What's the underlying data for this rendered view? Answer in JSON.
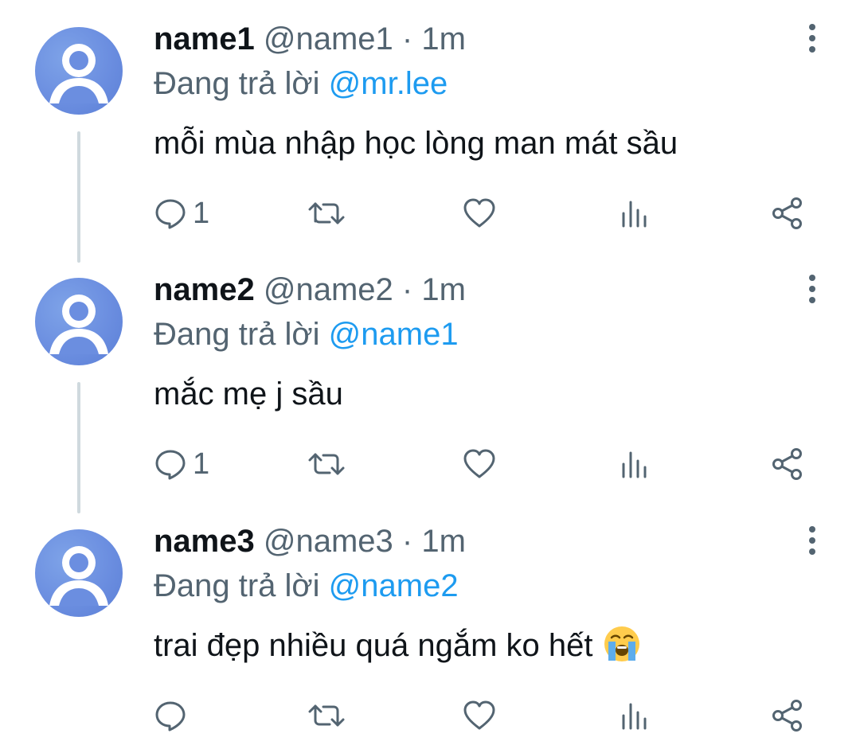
{
  "tweets": [
    {
      "display_name": "name1",
      "handle": "@name1",
      "separator": "·",
      "time": "1m",
      "reply_prefix": "Đang trả lời",
      "reply_to": "@mr.lee",
      "text": "mỗi mùa nhập học lòng man mát sầu",
      "reply_count": "1"
    },
    {
      "display_name": "name2",
      "handle": "@name2",
      "separator": "·",
      "time": "1m",
      "reply_prefix": "Đang trả lời",
      "reply_to": "@name1",
      "text": "mắc mẹ j sầu",
      "reply_count": "1"
    },
    {
      "display_name": "name3",
      "handle": "@name3",
      "separator": "·",
      "time": "1m",
      "reply_prefix": "Đang trả lời",
      "reply_to": "@name2",
      "text": "trai đẹp nhiều quá ngắm ko hết",
      "reply_count": "",
      "emoji": "loudly-crying-face"
    }
  ],
  "colors": {
    "text_primary": "#0f1419",
    "text_secondary": "#536471",
    "link": "#1d9bf0",
    "thread_line": "#cfd9de",
    "avatar": "#6b8ee0",
    "icon": "#536471"
  },
  "icons": {
    "reply": "comment-bubble-icon",
    "retweet": "retweet-icon",
    "like": "heart-icon",
    "views": "bar-chart-icon",
    "share": "share-icon",
    "more": "more-vertical-icon",
    "avatar": "default-user-avatar"
  }
}
